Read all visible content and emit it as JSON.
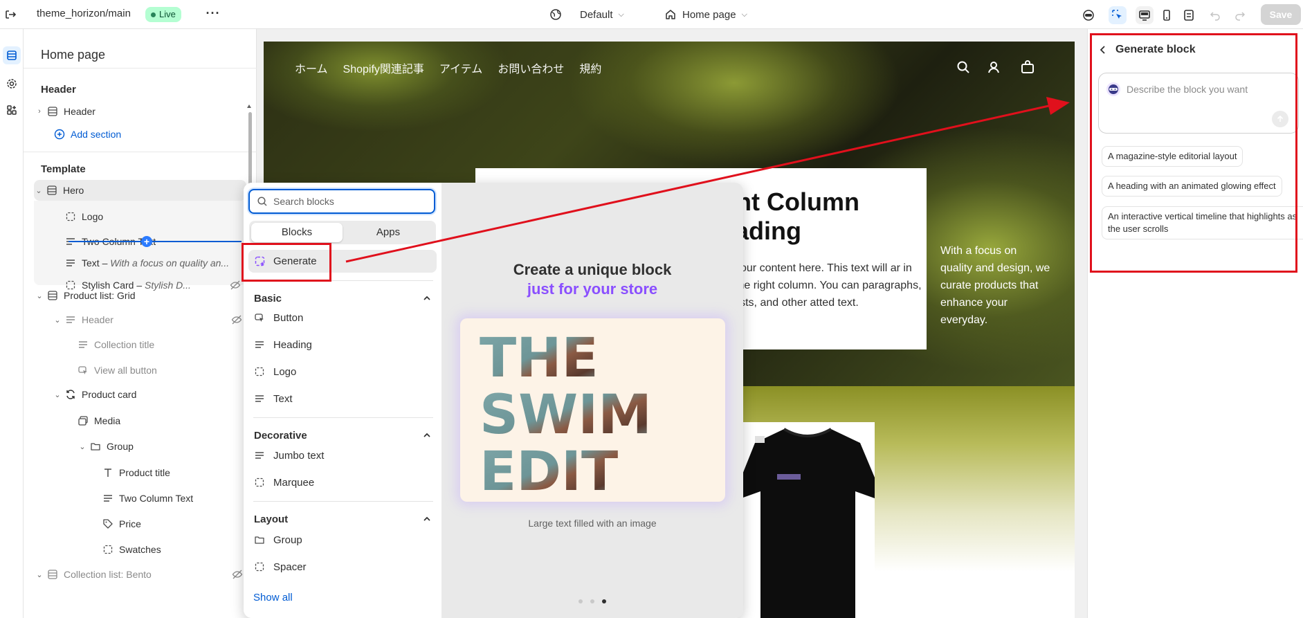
{
  "topbar": {
    "theme_name": "theme_horizon/main",
    "status_badge": "Live",
    "more_label": "···",
    "template_selector": "Default",
    "page_selector": "Home page",
    "save_label": "Save"
  },
  "sidebar": {
    "title": "Home page",
    "header_section_label": "Header",
    "header_item": "Header",
    "add_section_label": "Add section",
    "template_section_label": "Template",
    "tree": [
      {
        "label": "Hero",
        "italic": ""
      },
      {
        "label": "Logo",
        "italic": ""
      },
      {
        "label": "Two Column Text",
        "italic": ""
      },
      {
        "label": "Text – ",
        "italic": "With a focus on quality an..."
      },
      {
        "label": "Stylish Card – ",
        "italic": "Stylish D..."
      },
      {
        "label": "Product list: Grid",
        "italic": ""
      },
      {
        "label": "Header",
        "italic": ""
      },
      {
        "label": "Collection title",
        "italic": ""
      },
      {
        "label": "View all button",
        "italic": ""
      },
      {
        "label": "Product card",
        "italic": ""
      },
      {
        "label": "Media",
        "italic": ""
      },
      {
        "label": "Group",
        "italic": ""
      },
      {
        "label": "Product title",
        "italic": ""
      },
      {
        "label": "Two Column Text",
        "italic": ""
      },
      {
        "label": "Price",
        "italic": ""
      },
      {
        "label": "Swatches",
        "italic": ""
      },
      {
        "label": "Collection list: Bento",
        "italic": ""
      }
    ]
  },
  "preview": {
    "nav": [
      "ホーム",
      "Shopify関連記事",
      "アイテム",
      "お問い合わせ",
      "規約"
    ],
    "hero_heading": "ght Column eading",
    "hero_paragraph": "your content here. This text will ar in the right column. You can paragraphs, lists, and other atted text.",
    "hero_side_text": "With a focus on quality and design, we curate products that enhance your everyday."
  },
  "blocks_popover": {
    "search_placeholder": "Search blocks",
    "tab_blocks": "Blocks",
    "tab_apps": "Apps",
    "generate_label": "Generate",
    "sections": [
      {
        "title": "Basic",
        "items": [
          "Button",
          "Heading",
          "Logo",
          "Text"
        ]
      },
      {
        "title": "Decorative",
        "items": [
          "Jumbo text",
          "Marquee"
        ]
      },
      {
        "title": "Layout",
        "items": [
          "Group",
          "Spacer"
        ]
      }
    ],
    "show_all": "Show all",
    "promo_title": "Create a unique block",
    "promo_subtitle": "just for your store",
    "promo_image_text": [
      "THE",
      "SWIM",
      "EDIT"
    ],
    "promo_caption": "Large text filled with an image",
    "carousel_active_index": 2
  },
  "generate_panel": {
    "title": "Generate block",
    "input_placeholder": "Describe the block you want",
    "suggestions": [
      "A magazine-style editorial layout",
      "A heading with an animated glowing effect",
      "An interactive vertical timeline that highlights as the user scrolls"
    ]
  },
  "colors": {
    "annotation_red": "#e0101c",
    "accent_blue": "#005bd3",
    "generate_purple": "#8a4fff",
    "live_green": "#b4fed2"
  }
}
